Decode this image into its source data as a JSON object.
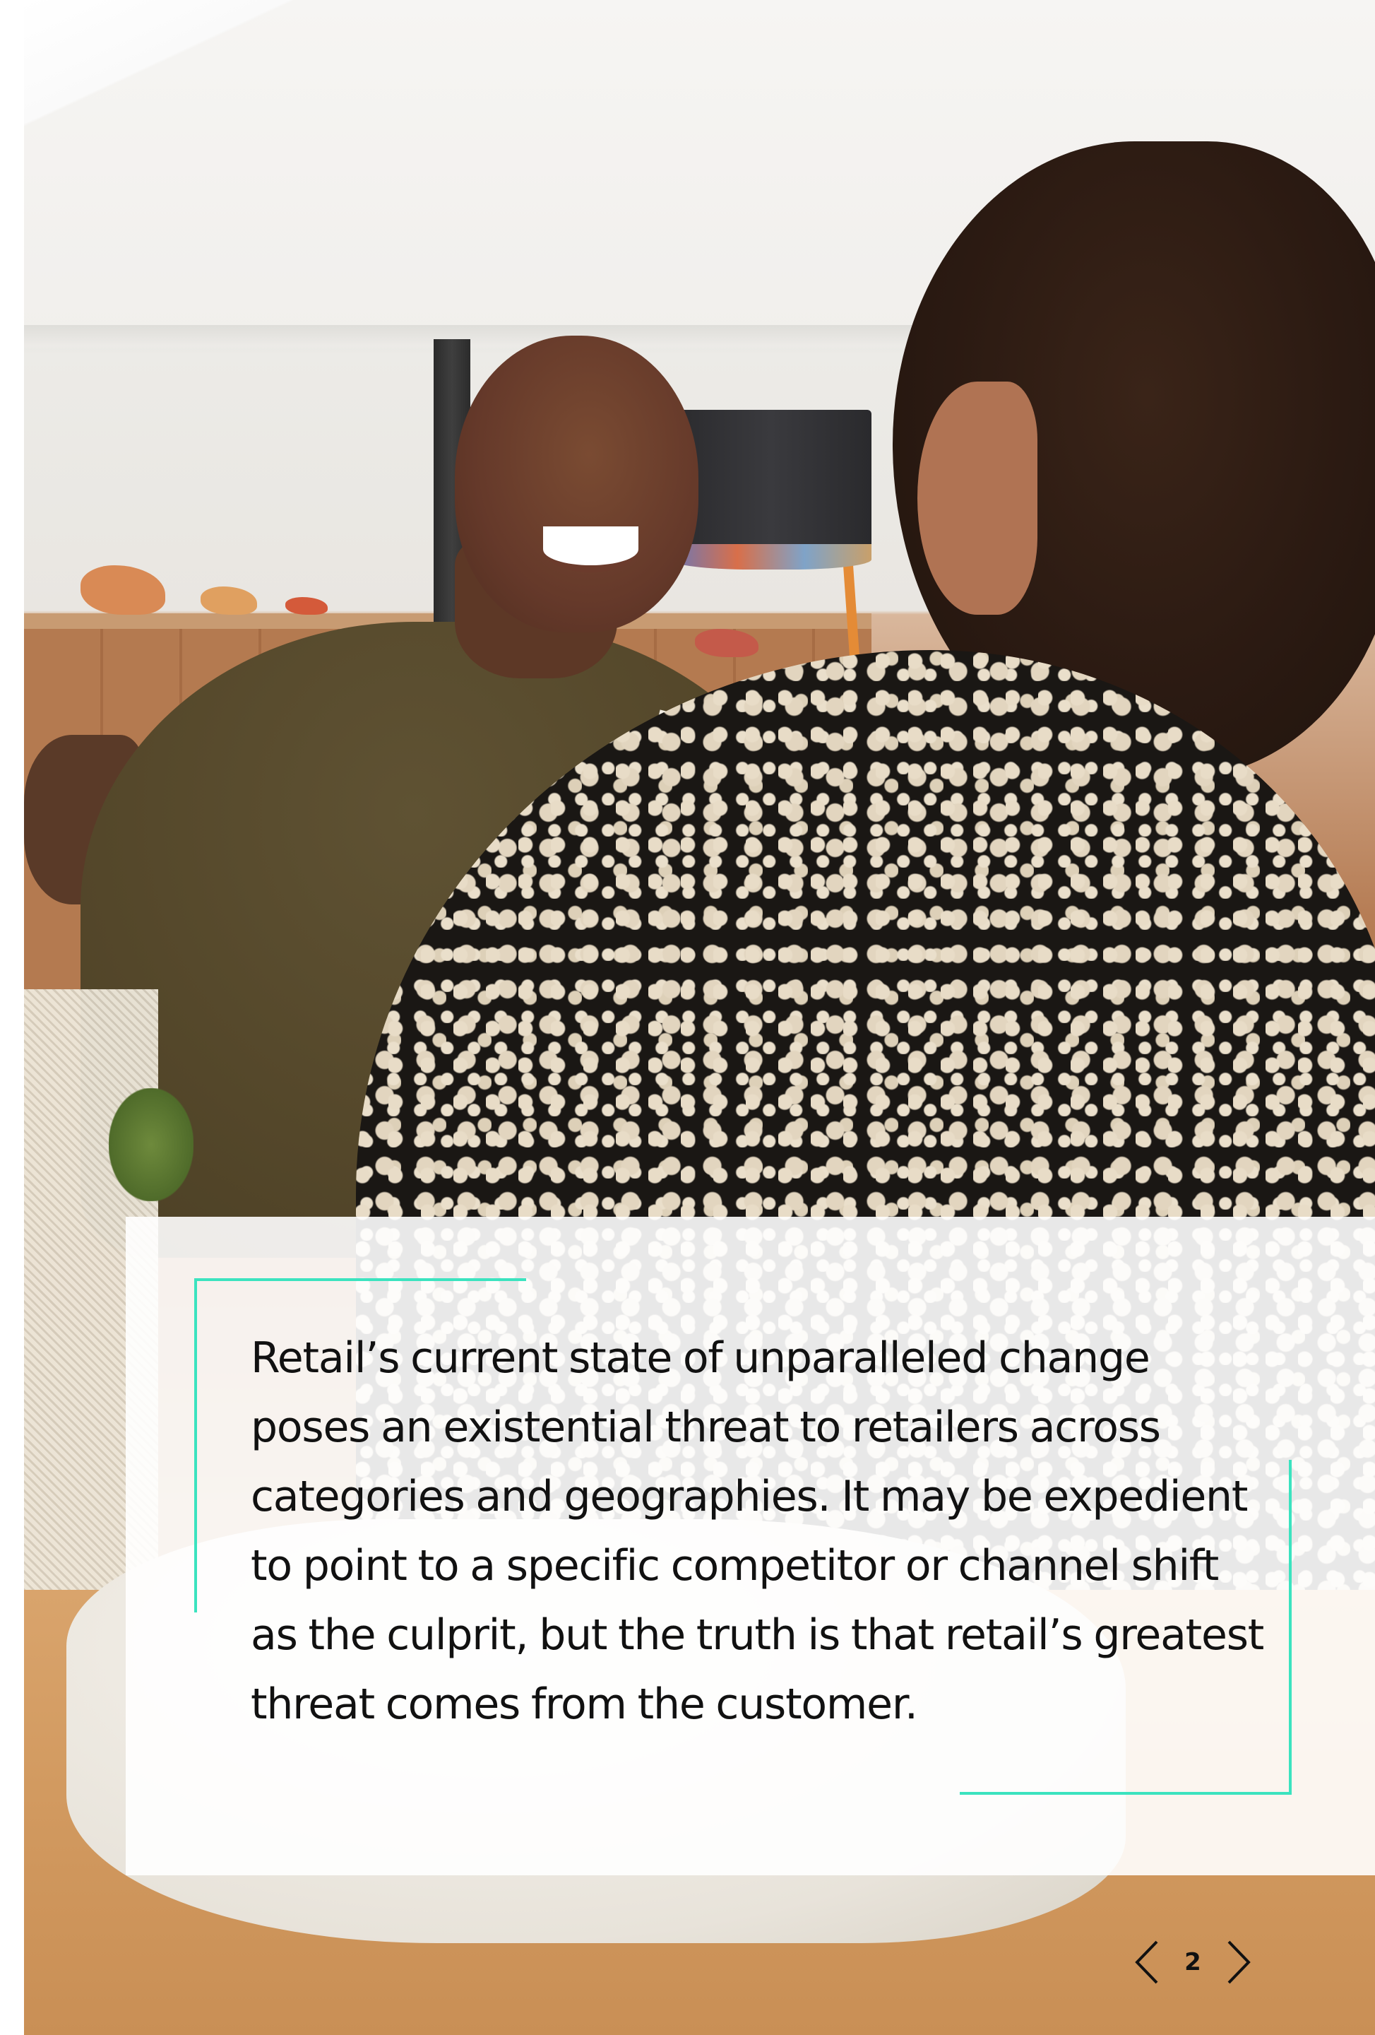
{
  "quote": {
    "text": "Retail’s current state of unparalleled change poses an existential threat to retailers across categories and geographies. It may be expedient to point to a specific competitor or channel shift as the culprit, but the truth is that retail’s greatest threat comes from the customer."
  },
  "pagination": {
    "current_page": "2",
    "prev_icon": "chevron-left-icon",
    "next_icon": "chevron-right-icon"
  },
  "colors": {
    "accent": "#3be3bf",
    "text": "#111111",
    "panel": "#ffffff"
  }
}
